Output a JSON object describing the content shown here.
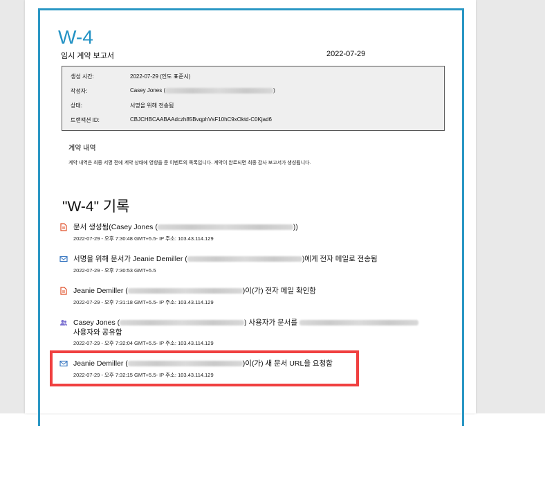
{
  "document": {
    "title": "W-4",
    "subtitle": "임시 계약 보고서",
    "date": "2022-07-29"
  },
  "info": {
    "rows": [
      {
        "label": "생성 시간:",
        "value": "2022-07-29 (인도 표준시)"
      },
      {
        "label": "작성자:",
        "value": "Casey Jones (",
        "suffix": ")"
      },
      {
        "label": "상태:",
        "value": "서명을 위해 전송됨"
      },
      {
        "label": "트랜잭션 ID:",
        "value": "CBJCHBCAABAAdczh85BvqphVsF10hC9xOktd-C0Kjad6"
      }
    ]
  },
  "section": {
    "title": "계약 내역",
    "description": "계약 내역은 최종 서명 전에 계약 상태에 영향을 준 이벤트의 목록입니다. 계약이 완료되면 최종 감사 보고서가 생성됩니다."
  },
  "history": {
    "title": "\"W-4\" 기록",
    "events": [
      {
        "icon": "document-icon",
        "text_a": "문서 생성됨(Casey Jones (",
        "text_b": "))",
        "meta": "2022-07-29 - 오후 7:30:48 GMT+5.5- IP 주소: 103.43.114.129"
      },
      {
        "icon": "email-icon",
        "text_a": "서명을 위해 문서가 Jeanie Demiller (",
        "text_b": ")에게 전자 메일로 전송됨",
        "meta": "2022-07-29 - 오후 7:30:53 GMT+5.5"
      },
      {
        "icon": "document-icon",
        "text_a": "Jeanie Demiller (",
        "text_b": ")이(가) 전자 메일 확인함",
        "meta": "2022-07-29 - 오후 7:31:18 GMT+5.5- IP 주소: 103.43.114.129"
      },
      {
        "icon": "users-icon",
        "text_a": "Casey Jones (",
        "text_b": ") 사용자가 문서를",
        "text_c": "사용자와 공유함",
        "meta": "2022-07-29 - 오후 7:32:04 GMT+5.5- IP 주소: 103.43.114.129"
      },
      {
        "icon": "email-icon",
        "text_a": "Jeanie Demiller (",
        "text_b": ")이(가) 새 문서 URL을 요청함",
        "meta": "2022-07-29 - 오후 7:32:15 GMT+5.5- IP 주소: 103.43.114.129"
      }
    ]
  },
  "colors": {
    "accent": "#2a97c4",
    "highlight": "#f04040",
    "icon_red": "#e0502a",
    "icon_blue": "#3a78c2",
    "icon_purple": "#7a6fd0"
  }
}
